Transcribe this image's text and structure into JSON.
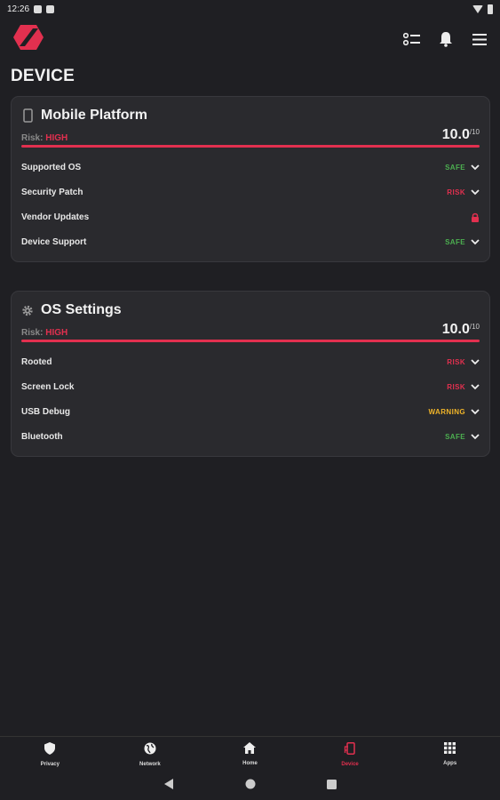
{
  "status_bar": {
    "time": "12:26"
  },
  "page": {
    "title": "DEVICE"
  },
  "colors": {
    "accent": "#e2304f",
    "safe": "#4caf50",
    "risk": "#e2304f",
    "warning": "#f0b429"
  },
  "cards": [
    {
      "title": "Mobile Platform",
      "icon": "phone-icon",
      "risk_label": "Risk:",
      "risk_level": "HIGH",
      "score": "10.0",
      "score_den": "/10",
      "items": [
        {
          "label": "Supported OS",
          "status": "SAFE"
        },
        {
          "label": "Security Patch",
          "status": "RISK"
        },
        {
          "label": "Vendor Updates",
          "status": ""
        },
        {
          "label": "Device Support",
          "status": "SAFE"
        }
      ]
    },
    {
      "title": "OS Settings",
      "icon": "gear-icon",
      "risk_label": "Risk:",
      "risk_level": "HIGH",
      "score": "10.0",
      "score_den": "/10",
      "items": [
        {
          "label": "Rooted",
          "status": "RISK"
        },
        {
          "label": "Screen Lock",
          "status": "RISK"
        },
        {
          "label": "USB Debug",
          "status": "WARNING"
        },
        {
          "label": "Bluetooth",
          "status": "SAFE"
        }
      ]
    }
  ],
  "nav": [
    {
      "label": "Privacy",
      "icon": "shield-icon"
    },
    {
      "label": "Network",
      "icon": "globe-icon"
    },
    {
      "label": "Home",
      "icon": "home-icon"
    },
    {
      "label": "Device",
      "icon": "device-icon"
    },
    {
      "label": "Apps",
      "icon": "apps-grid-icon"
    }
  ]
}
